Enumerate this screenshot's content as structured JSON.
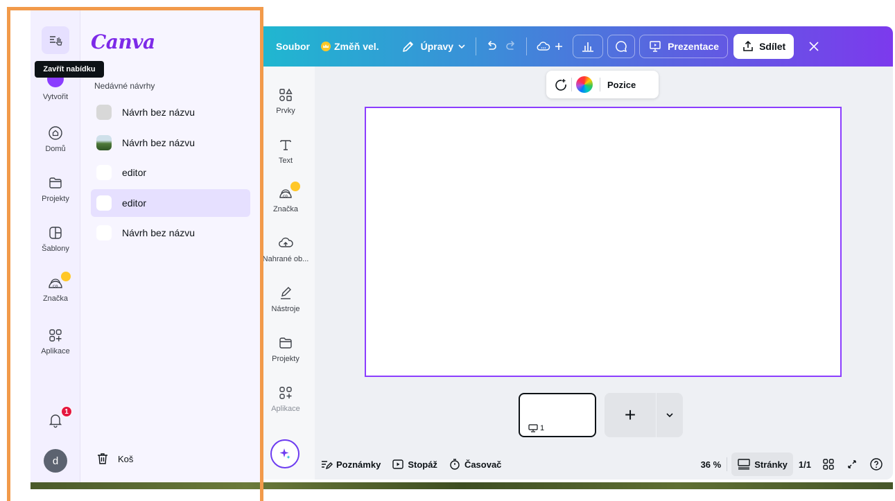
{
  "left_nav": {
    "logo": "Canva",
    "tooltip": "Zavřít nabídku",
    "rail": [
      {
        "label": "Vytvořit"
      },
      {
        "label": "Domů"
      },
      {
        "label": "Projekty"
      },
      {
        "label": "Šablony"
      },
      {
        "label": "Značka"
      },
      {
        "label": "Aplikace"
      }
    ],
    "notifications_count": "1",
    "avatar_initial": "d",
    "recent_title": "Nedávné návrhy",
    "recent": [
      {
        "label": "Návrh bez názvu"
      },
      {
        "label": "Návrh bez názvu"
      },
      {
        "label": "editor"
      },
      {
        "label": "editor"
      },
      {
        "label": "Návrh bez názvu"
      }
    ],
    "trash_label": "Koš"
  },
  "toolbar": {
    "file": "Soubor",
    "resize": "Změň vel.",
    "edits": "Úpravy",
    "present": "Prezentace",
    "share": "Sdílet"
  },
  "side_panel": [
    {
      "label": "Prvky"
    },
    {
      "label": "Text"
    },
    {
      "label": "Značka"
    },
    {
      "label": "Nahrané ob..."
    },
    {
      "label": "Nástroje"
    },
    {
      "label": "Projekty"
    },
    {
      "label": "Aplikace"
    }
  ],
  "context_bar": {
    "position": "Pozice"
  },
  "pages": {
    "thumb_number": "1",
    "add": "+"
  },
  "bottom_bar": {
    "notes": "Poznámky",
    "footage": "Stopáž",
    "timer": "Časovač",
    "zoom": "36 %",
    "pages": "Stránky",
    "page_count": "1/1"
  },
  "colors": {
    "accent": "#8b3dff",
    "frame": "#f29a4a",
    "badge": "#e5173f",
    "crown": "#ffc727"
  }
}
